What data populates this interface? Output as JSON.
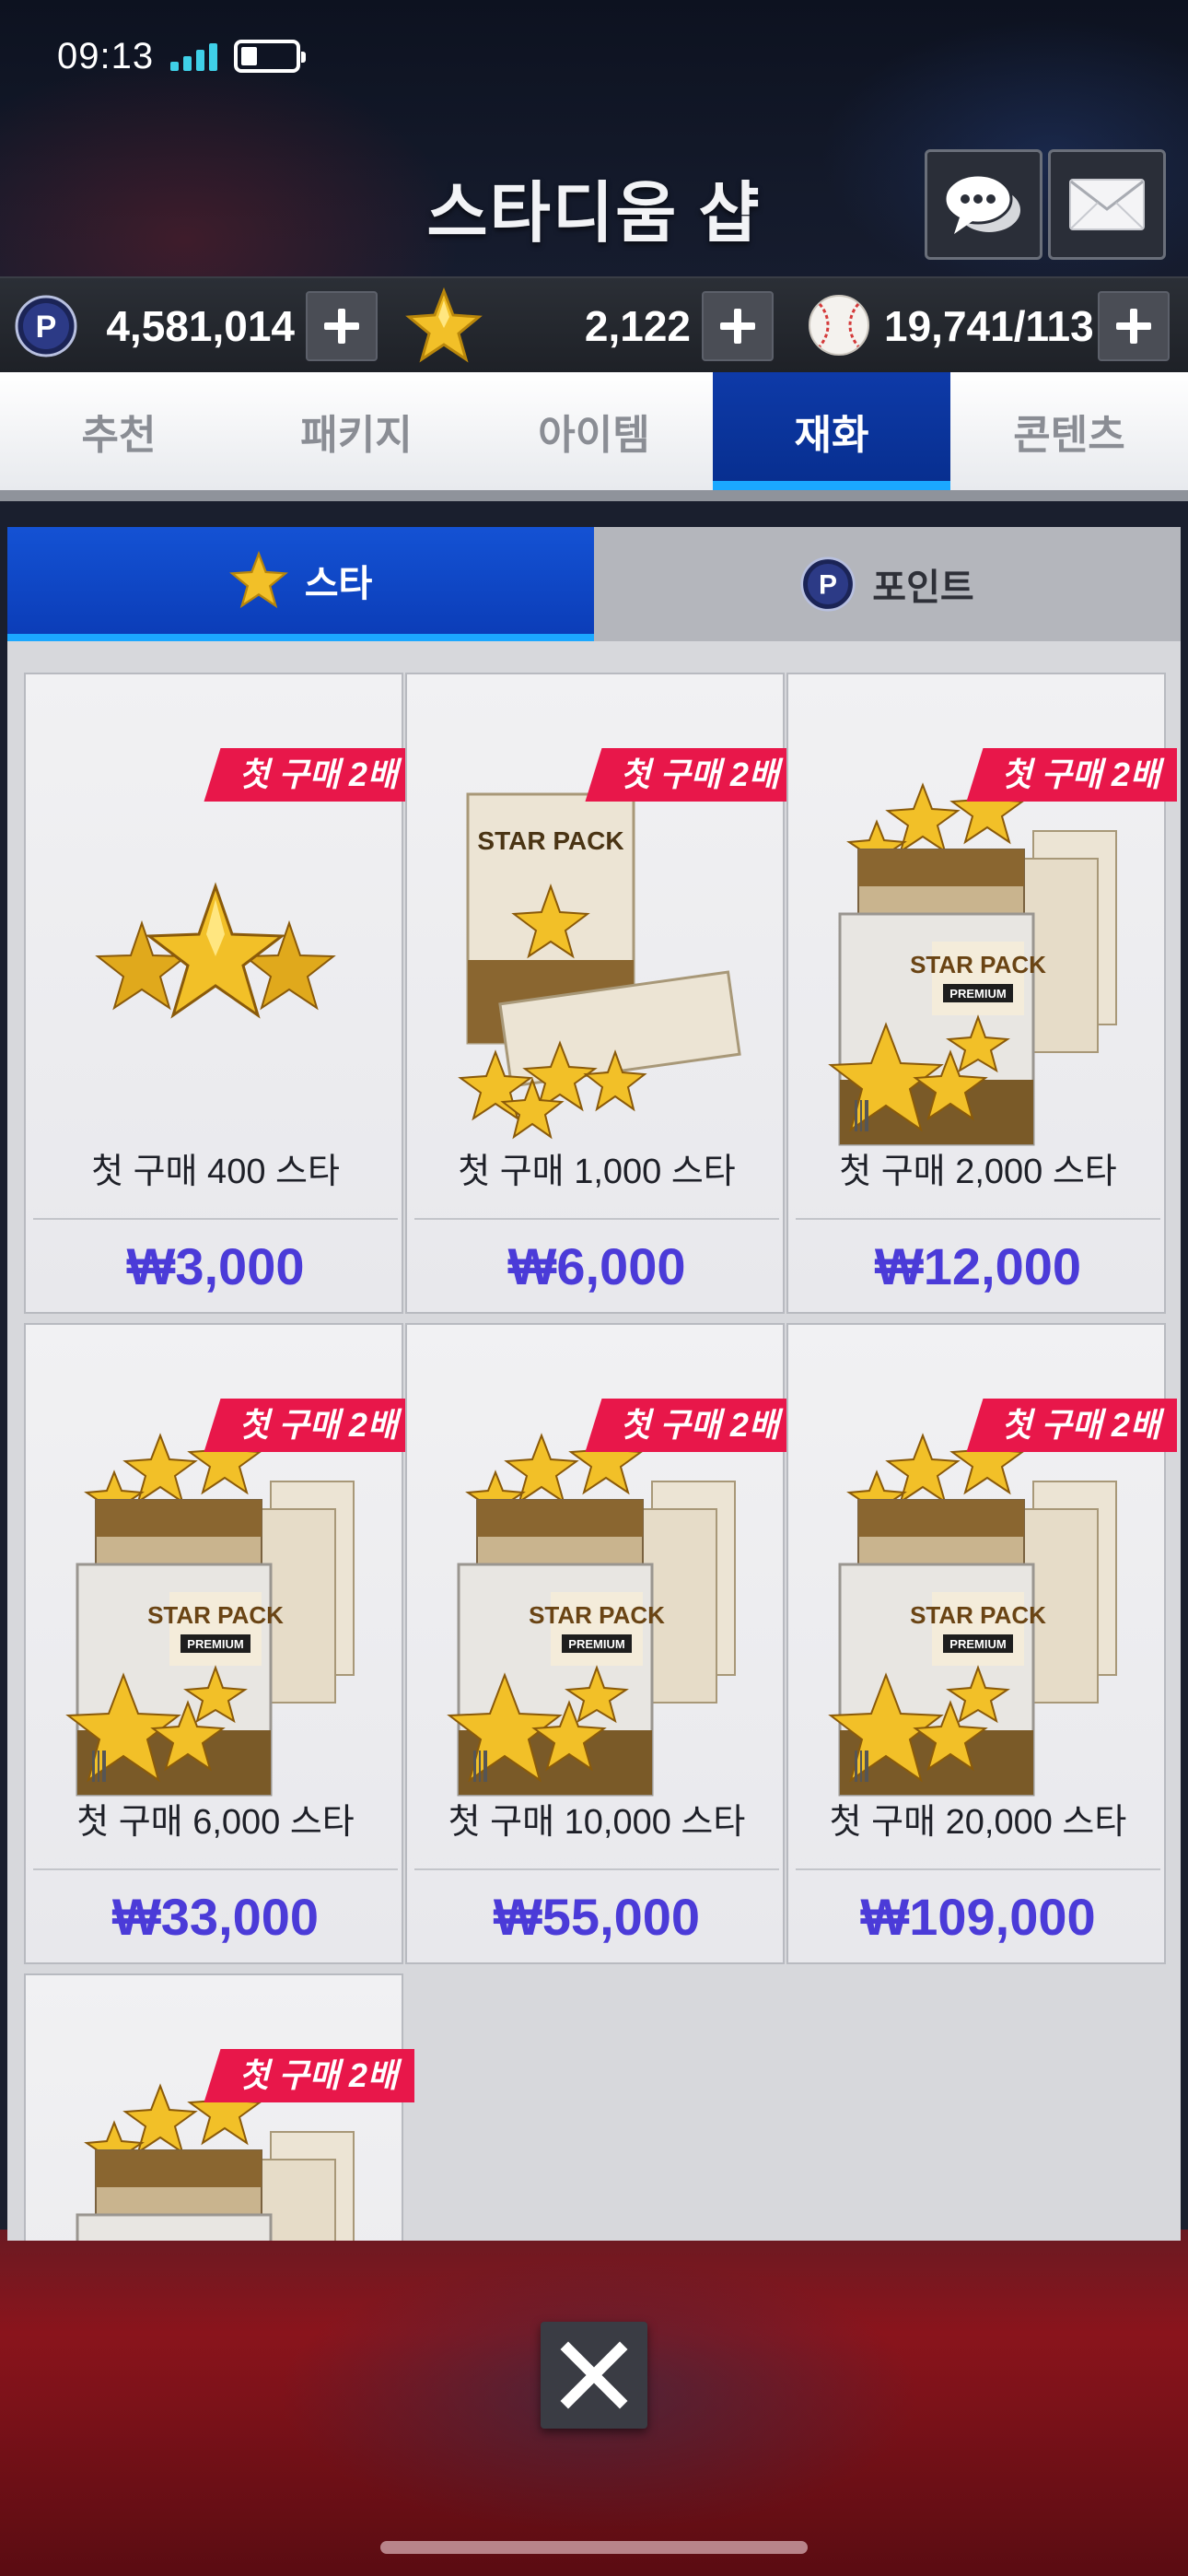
{
  "status_bar": {
    "time": "09:13"
  },
  "header": {
    "title": "스타디움 샵"
  },
  "currencies": {
    "points": "4,581,014",
    "stars": "2,122",
    "balls": "19,741/113"
  },
  "tabs": [
    {
      "label": "추천",
      "active": false
    },
    {
      "label": "패키지",
      "active": false
    },
    {
      "label": "아이템",
      "active": false
    },
    {
      "label": "재화",
      "active": true
    },
    {
      "label": "콘텐츠",
      "active": false
    }
  ],
  "subtabs": [
    {
      "label": "스타",
      "active": true
    },
    {
      "label": "포인트",
      "active": false
    }
  ],
  "products": [
    {
      "badge": "첫 구매 2배",
      "title": "첫 구매 400 스타",
      "price": "₩3,000",
      "art": "stars"
    },
    {
      "badge": "첫 구매 2배",
      "title": "첫 구매 1,000 스타",
      "price": "₩6,000",
      "art": "star-pack-open"
    },
    {
      "badge": "첫 구매 2배",
      "title": "첫 구매 2,000 스타",
      "price": "₩12,000",
      "art": "star-pack-premium"
    },
    {
      "badge": "첫 구매 2배",
      "title": "첫 구매 6,000 스타",
      "price": "₩33,000",
      "art": "star-pack-premium"
    },
    {
      "badge": "첫 구매 2배",
      "title": "첫 구매 10,000 스타",
      "price": "₩55,000",
      "art": "star-pack-premium"
    },
    {
      "badge": "첫 구매 2배",
      "title": "첫 구매 20,000 스타",
      "price": "₩109,000",
      "art": "star-pack-premium"
    },
    {
      "badge": "첫 구매 2배",
      "title": "",
      "price": "",
      "art": "star-pack-premium"
    }
  ],
  "pack_labels": {
    "brand": "STAR PACK",
    "tier": "PREMIUM"
  },
  "colors": {
    "accent_blue": "#0b3db8",
    "tab_underline": "#1ba8ff",
    "ribbon_red": "#e8174a",
    "price_purple": "#4b3bd8",
    "star_gold": "#f2c028"
  }
}
